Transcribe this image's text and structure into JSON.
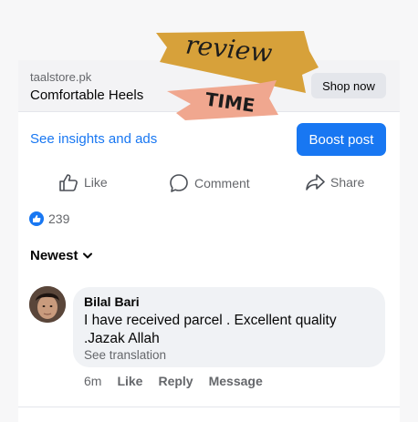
{
  "ad": {
    "domain": "taalstore.pk",
    "title": "Comfortable Heels",
    "cta_label": "Shop now"
  },
  "sticker": {
    "line1": "review",
    "line2": "TIME",
    "colors": {
      "ribbon_top": "#d7a13a",
      "ribbon_bottom": "#f0a78f"
    }
  },
  "insights": {
    "link_label": "See insights and ads",
    "boost_label": "Boost post"
  },
  "actions": {
    "like_label": "Like",
    "comment_label": "Comment",
    "share_label": "Share"
  },
  "reactions": {
    "count": "239",
    "icon": "thumbs-up-icon"
  },
  "comments": {
    "sort_label": "Newest",
    "items": [
      {
        "author": "Bilal Bari",
        "text": "I have received parcel . Excellent quality .Jazak Allah",
        "translation_label": "See translation",
        "time": "6m",
        "like_label": "Like",
        "reply_label": "Reply",
        "message_label": "Message"
      }
    ]
  },
  "colors": {
    "accent": "#1877f2",
    "muted": "#65676b",
    "bubble": "#f0f2f5"
  }
}
